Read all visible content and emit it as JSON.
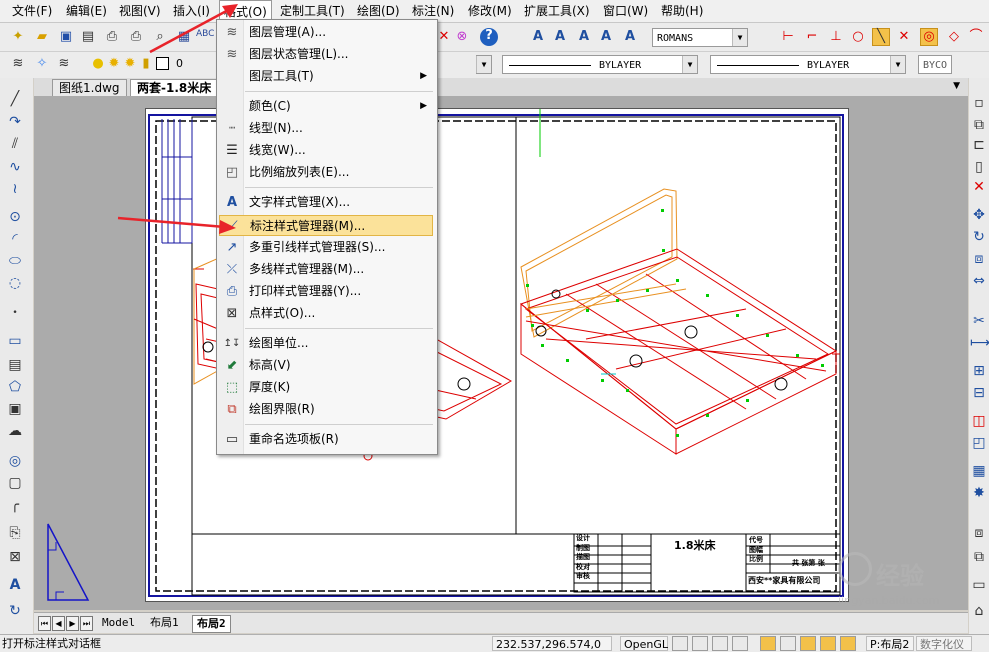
{
  "menubar": {
    "items": [
      "文件(F)",
      "编辑(E)",
      "视图(V)",
      "插入(I)",
      "格式(O)",
      "定制工具(T)",
      "绘图(D)",
      "标注(N)",
      "修改(M)",
      "扩展工具(X)",
      "窗口(W)",
      "帮助(H)"
    ]
  },
  "toolbar2": {
    "layer_value": "0",
    "font_combo": "ROMANS",
    "linetype_combo": "BYLAYER",
    "lineweight_combo": "BYLAYER",
    "color_combo": "BYCO"
  },
  "doc_tabs": [
    "图纸1.dwg",
    "两套-1.8米床"
  ],
  "format_menu": {
    "items": [
      {
        "label": "图层管理(A)...",
        "icon": "layers-icon"
      },
      {
        "label": "图层状态管理(L)...",
        "icon": "layer-state-icon"
      },
      {
        "label": "图层工具(T)",
        "icon": "",
        "submenu": "▶"
      },
      {
        "label": "颜色(C)",
        "icon": "",
        "submenu": "▶"
      },
      {
        "label": "线型(N)...",
        "icon": "linetype-icon"
      },
      {
        "label": "线宽(W)...",
        "icon": "lineweight-icon"
      },
      {
        "label": "比例缩放列表(E)...",
        "icon": "scale-list-icon"
      },
      {
        "label": "文字样式管理(X)...",
        "icon": "text-style-icon"
      },
      {
        "label": "标注样式管理器(M)...",
        "icon": "dim-style-icon"
      },
      {
        "label": "多重引线样式管理器(S)...",
        "icon": "mleader-style-icon"
      },
      {
        "label": "多线样式管理器(M)...",
        "icon": "mline-style-icon"
      },
      {
        "label": "打印样式管理器(Y)...",
        "icon": "plot-style-icon"
      },
      {
        "label": "点样式(O)...",
        "icon": "point-style-icon"
      },
      {
        "label": "绘图单位...",
        "icon": "units-icon"
      },
      {
        "label": "标高(V)",
        "icon": "elevation-icon"
      },
      {
        "label": "厚度(K)",
        "icon": "thickness-icon"
      },
      {
        "label": "绘图界限(R)",
        "icon": "limits-icon"
      },
      {
        "label": "重命名选项板(R)",
        "icon": "rename-icon"
      }
    ]
  },
  "title_block": {
    "title": "1.8米床",
    "rows_left": [
      "设计",
      "制图",
      "描图",
      "校对",
      "审核"
    ],
    "right_labels": [
      "代号",
      "图幅",
      "比例",
      "共 张第 张"
    ],
    "company": "西安**家具有限公司"
  },
  "layout_tabs": [
    "Model",
    "布局1",
    "布局2"
  ],
  "statusbar": {
    "message": "打开标注样式对话框",
    "coords": "232.537,296.574,0",
    "renderer": "OpenGL",
    "layout": "P:布局2",
    "digital": "数字化仪"
  },
  "watermark": {
    "text": "经验",
    "sub": "jingyan.baidu.com"
  },
  "colors": {
    "highlight": "#fbe29a",
    "arrow": "#e8232a",
    "drawing_red": "#e00000",
    "drawing_green": "#00cc00",
    "drawing_orange": "#e89020"
  }
}
